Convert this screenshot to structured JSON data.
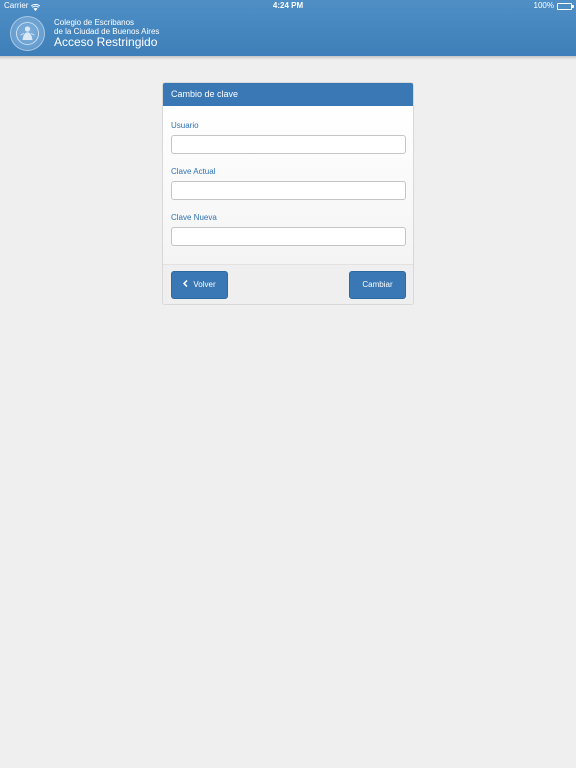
{
  "status_bar": {
    "carrier": "Carrier",
    "time": "4:24 PM",
    "battery": "100%"
  },
  "header": {
    "org_line1": "Colegio de Escribanos",
    "org_line2": "de la Ciudad de Buenos Aires",
    "title": "Acceso Restringido",
    "logo_icon": "seal-logo-icon"
  },
  "form": {
    "title": "Cambio de clave",
    "fields": [
      {
        "label": "Usuario",
        "value": "",
        "placeholder": ""
      },
      {
        "label": "Clave Actual",
        "value": "",
        "placeholder": ""
      },
      {
        "label": "Clave Nueva",
        "value": "",
        "placeholder": ""
      }
    ],
    "back_label": "Volver",
    "back_icon": "chevron-left-icon",
    "submit_label": "Cambiar"
  },
  "colors": {
    "header_bg": "#4a8ac2",
    "accent": "#3a78b5",
    "label": "#2f73b3",
    "page_bg": "#efefef"
  }
}
